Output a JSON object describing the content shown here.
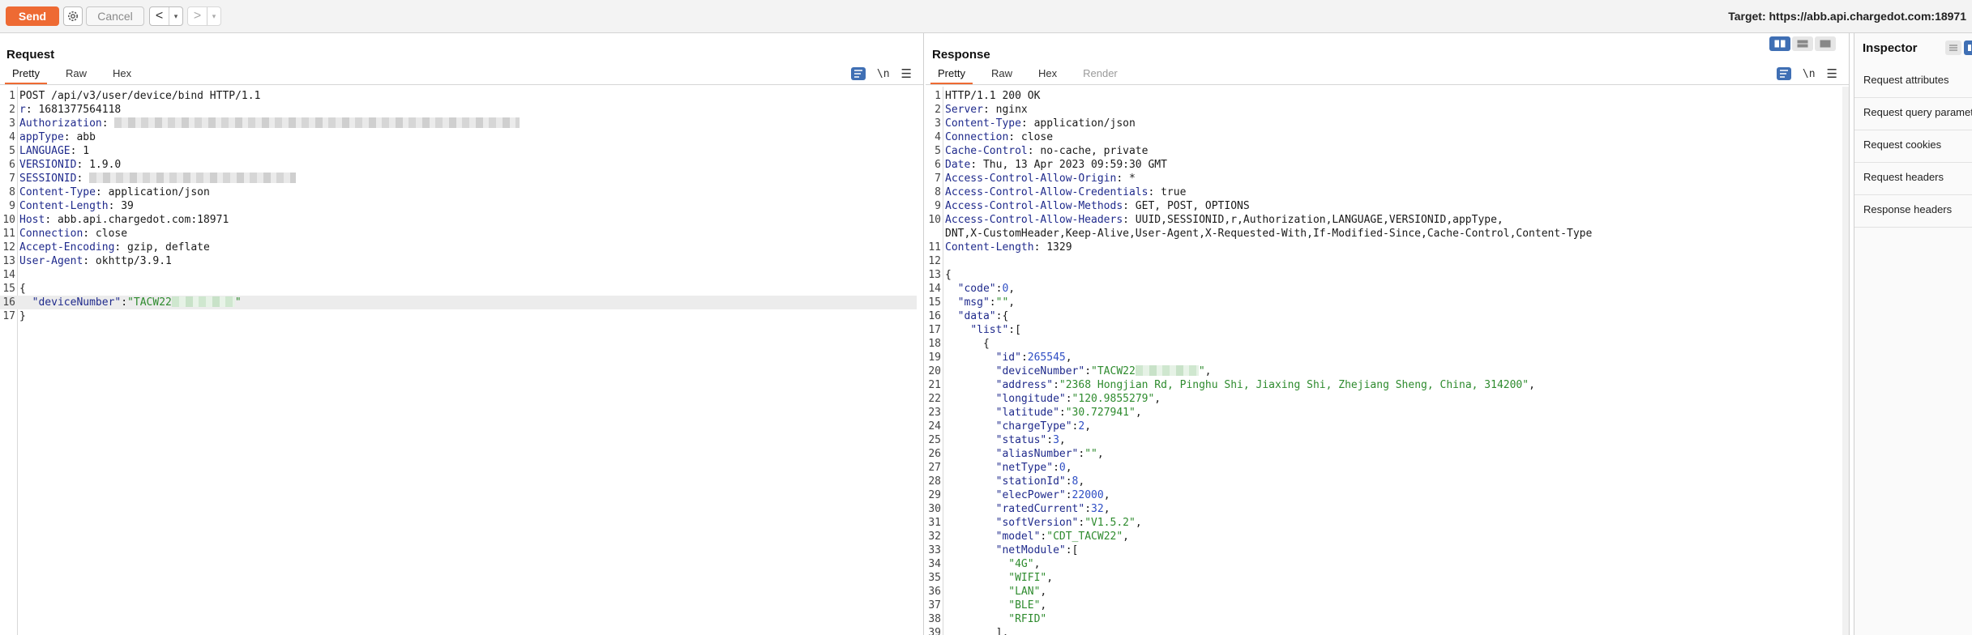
{
  "toolbar": {
    "send_label": "Send",
    "cancel_label": "Cancel",
    "back_arrow": "<",
    "forward_arrow": ">",
    "dropdown_glyph": "▾",
    "target_label": "Target: https://abb.api.chargedot.com:18971",
    "icons": [
      "gear-icon",
      "chevron-left-icon",
      "chevron-right-icon",
      "chevron-down-icon"
    ]
  },
  "colors": {
    "accent": "#ee6a33",
    "key": "#1f2a8c",
    "string": "#2e8b2e",
    "number": "#2e4ec4",
    "tool_blue": "#3f6fb4"
  },
  "request": {
    "title": "Request",
    "tabs": [
      "Pretty",
      "Raw",
      "Hex"
    ],
    "active_tab": "Pretty",
    "tools": {
      "newline_label": "\\n",
      "menu_glyph": "☰"
    },
    "lines": [
      [
        {
          "t": "p",
          "v": "POST /api/v3/user/device/bind HTTP/1.1"
        }
      ],
      [
        {
          "t": "k",
          "v": "r"
        },
        {
          "t": "p",
          "v": ": 1681377564118"
        }
      ],
      [
        {
          "t": "k",
          "v": "Authorization"
        },
        {
          "t": "p",
          "v": ": "
        },
        {
          "t": "r",
          "w": 500
        }
      ],
      [
        {
          "t": "k",
          "v": "appType"
        },
        {
          "t": "p",
          "v": ": abb"
        }
      ],
      [
        {
          "t": "k",
          "v": "LANGUAGE"
        },
        {
          "t": "p",
          "v": ": 1"
        }
      ],
      [
        {
          "t": "k",
          "v": "VERSIONID"
        },
        {
          "t": "p",
          "v": ": 1.9.0"
        }
      ],
      [
        {
          "t": "k",
          "v": "SESSIONID"
        },
        {
          "t": "p",
          "v": ": "
        },
        {
          "t": "r",
          "w": 255
        }
      ],
      [
        {
          "t": "k",
          "v": "Content-Type"
        },
        {
          "t": "p",
          "v": ": application/json"
        }
      ],
      [
        {
          "t": "k",
          "v": "Content-Length"
        },
        {
          "t": "p",
          "v": ": 39"
        }
      ],
      [
        {
          "t": "k",
          "v": "Host"
        },
        {
          "t": "p",
          "v": ": abb.api.chargedot.com:18971"
        }
      ],
      [
        {
          "t": "k",
          "v": "Connection"
        },
        {
          "t": "p",
          "v": ": close"
        }
      ],
      [
        {
          "t": "k",
          "v": "Accept-Encoding"
        },
        {
          "t": "p",
          "v": ": gzip, deflate"
        }
      ],
      [
        {
          "t": "k",
          "v": "User-Agent"
        },
        {
          "t": "p",
          "v": ": okhttp/3.9.1"
        }
      ],
      [],
      [
        {
          "t": "p",
          "v": "{"
        }
      ],
      [
        {
          "t": "p",
          "v": "  "
        },
        {
          "t": "k",
          "v": "\"deviceNumber\""
        },
        {
          "t": "p",
          "v": ":"
        },
        {
          "t": "s",
          "v": "\"TACW22"
        },
        {
          "t": "rg",
          "w": 78
        },
        {
          "t": "s",
          "v": "\""
        }
      ],
      [
        {
          "t": "p",
          "v": "}"
        }
      ]
    ],
    "highlight_line": 16
  },
  "response": {
    "title": "Response",
    "tabs": [
      "Pretty",
      "Raw",
      "Hex",
      "Render"
    ],
    "active_tab": "Pretty",
    "disabled_tab": "Render",
    "tools": {
      "newline_label": "\\n",
      "menu_glyph": "☰"
    },
    "lines": [
      [
        {
          "t": "p",
          "v": "HTTP/1.1 200 OK"
        }
      ],
      [
        {
          "t": "k",
          "v": "Server"
        },
        {
          "t": "p",
          "v": ": nginx"
        }
      ],
      [
        {
          "t": "k",
          "v": "Content-Type"
        },
        {
          "t": "p",
          "v": ": application/json"
        }
      ],
      [
        {
          "t": "k",
          "v": "Connection"
        },
        {
          "t": "p",
          "v": ": close"
        }
      ],
      [
        {
          "t": "k",
          "v": "Cache-Control"
        },
        {
          "t": "p",
          "v": ": no-cache, private"
        }
      ],
      [
        {
          "t": "k",
          "v": "Date"
        },
        {
          "t": "p",
          "v": ": Thu, 13 Apr 2023 09:59:30 GMT"
        }
      ],
      [
        {
          "t": "k",
          "v": "Access-Control-Allow-Origin"
        },
        {
          "t": "p",
          "v": ": *"
        }
      ],
      [
        {
          "t": "k",
          "v": "Access-Control-Allow-Credentials"
        },
        {
          "t": "p",
          "v": ": true"
        }
      ],
      [
        {
          "t": "k",
          "v": "Access-Control-Allow-Methods"
        },
        {
          "t": "p",
          "v": ": GET, POST, OPTIONS"
        }
      ],
      [
        {
          "t": "k",
          "v": "Access-Control-Allow-Headers"
        },
        {
          "t": "p",
          "v": ": UUID,SESSIONID,r,Authorization,LANGUAGE,VERSIONID,appType,"
        }
      ],
      [
        {
          "t": "p",
          "v": "DNT,X-CustomHeader,Keep-Alive,User-Agent,X-Requested-With,If-Modified-Since,Cache-Control,Content-Type"
        }
      ],
      [
        {
          "t": "k",
          "v": "Content-Length"
        },
        {
          "t": "p",
          "v": ": 1329"
        }
      ],
      [],
      [
        {
          "t": "p",
          "v": "{"
        }
      ],
      [
        {
          "t": "p",
          "v": "  "
        },
        {
          "t": "k",
          "v": "\"code\""
        },
        {
          "t": "p",
          "v": ":"
        },
        {
          "t": "n",
          "v": "0"
        },
        {
          "t": "p",
          "v": ","
        }
      ],
      [
        {
          "t": "p",
          "v": "  "
        },
        {
          "t": "k",
          "v": "\"msg\""
        },
        {
          "t": "p",
          "v": ":"
        },
        {
          "t": "s",
          "v": "\"\""
        },
        {
          "t": "p",
          "v": ","
        }
      ],
      [
        {
          "t": "p",
          "v": "  "
        },
        {
          "t": "k",
          "v": "\"data\""
        },
        {
          "t": "p",
          "v": ":{"
        }
      ],
      [
        {
          "t": "p",
          "v": "    "
        },
        {
          "t": "k",
          "v": "\"list\""
        },
        {
          "t": "p",
          "v": ":["
        }
      ],
      [
        {
          "t": "p",
          "v": "      {"
        }
      ],
      [
        {
          "t": "p",
          "v": "        "
        },
        {
          "t": "k",
          "v": "\"id\""
        },
        {
          "t": "p",
          "v": ":"
        },
        {
          "t": "n",
          "v": "265545"
        },
        {
          "t": "p",
          "v": ","
        }
      ],
      [
        {
          "t": "p",
          "v": "        "
        },
        {
          "t": "k",
          "v": "\"deviceNumber\""
        },
        {
          "t": "p",
          "v": ":"
        },
        {
          "t": "s",
          "v": "\"TACW22"
        },
        {
          "t": "rg",
          "w": 78
        },
        {
          "t": "s",
          "v": "\""
        },
        {
          "t": "p",
          "v": ","
        }
      ],
      [
        {
          "t": "p",
          "v": "        "
        },
        {
          "t": "k",
          "v": "\"address\""
        },
        {
          "t": "p",
          "v": ":"
        },
        {
          "t": "s",
          "v": "\"2368 Hongjian Rd, Pinghu Shi, Jiaxing Shi, Zhejiang Sheng, China, 314200\""
        },
        {
          "t": "p",
          "v": ","
        }
      ],
      [
        {
          "t": "p",
          "v": "        "
        },
        {
          "t": "k",
          "v": "\"longitude\""
        },
        {
          "t": "p",
          "v": ":"
        },
        {
          "t": "s",
          "v": "\"120.9855279\""
        },
        {
          "t": "p",
          "v": ","
        }
      ],
      [
        {
          "t": "p",
          "v": "        "
        },
        {
          "t": "k",
          "v": "\"latitude\""
        },
        {
          "t": "p",
          "v": ":"
        },
        {
          "t": "s",
          "v": "\"30.727941\""
        },
        {
          "t": "p",
          "v": ","
        }
      ],
      [
        {
          "t": "p",
          "v": "        "
        },
        {
          "t": "k",
          "v": "\"chargeType\""
        },
        {
          "t": "p",
          "v": ":"
        },
        {
          "t": "n",
          "v": "2"
        },
        {
          "t": "p",
          "v": ","
        }
      ],
      [
        {
          "t": "p",
          "v": "        "
        },
        {
          "t": "k",
          "v": "\"status\""
        },
        {
          "t": "p",
          "v": ":"
        },
        {
          "t": "n",
          "v": "3"
        },
        {
          "t": "p",
          "v": ","
        }
      ],
      [
        {
          "t": "p",
          "v": "        "
        },
        {
          "t": "k",
          "v": "\"aliasNumber\""
        },
        {
          "t": "p",
          "v": ":"
        },
        {
          "t": "s",
          "v": "\"\""
        },
        {
          "t": "p",
          "v": ","
        }
      ],
      [
        {
          "t": "p",
          "v": "        "
        },
        {
          "t": "k",
          "v": "\"netType\""
        },
        {
          "t": "p",
          "v": ":"
        },
        {
          "t": "n",
          "v": "0"
        },
        {
          "t": "p",
          "v": ","
        }
      ],
      [
        {
          "t": "p",
          "v": "        "
        },
        {
          "t": "k",
          "v": "\"stationId\""
        },
        {
          "t": "p",
          "v": ":"
        },
        {
          "t": "n",
          "v": "8"
        },
        {
          "t": "p",
          "v": ","
        }
      ],
      [
        {
          "t": "p",
          "v": "        "
        },
        {
          "t": "k",
          "v": "\"elecPower\""
        },
        {
          "t": "p",
          "v": ":"
        },
        {
          "t": "n",
          "v": "22000"
        },
        {
          "t": "p",
          "v": ","
        }
      ],
      [
        {
          "t": "p",
          "v": "        "
        },
        {
          "t": "k",
          "v": "\"ratedCurrent\""
        },
        {
          "t": "p",
          "v": ":"
        },
        {
          "t": "n",
          "v": "32"
        },
        {
          "t": "p",
          "v": ","
        }
      ],
      [
        {
          "t": "p",
          "v": "        "
        },
        {
          "t": "k",
          "v": "\"softVersion\""
        },
        {
          "t": "p",
          "v": ":"
        },
        {
          "t": "s",
          "v": "\"V1.5.2\""
        },
        {
          "t": "p",
          "v": ","
        }
      ],
      [
        {
          "t": "p",
          "v": "        "
        },
        {
          "t": "k",
          "v": "\"model\""
        },
        {
          "t": "p",
          "v": ":"
        },
        {
          "t": "s",
          "v": "\"CDT_TACW22\""
        },
        {
          "t": "p",
          "v": ","
        }
      ],
      [
        {
          "t": "p",
          "v": "        "
        },
        {
          "t": "k",
          "v": "\"netModule\""
        },
        {
          "t": "p",
          "v": ":["
        }
      ],
      [
        {
          "t": "p",
          "v": "          "
        },
        {
          "t": "s",
          "v": "\"4G\""
        },
        {
          "t": "p",
          "v": ","
        }
      ],
      [
        {
          "t": "p",
          "v": "          "
        },
        {
          "t": "s",
          "v": "\"WIFI\""
        },
        {
          "t": "p",
          "v": ","
        }
      ],
      [
        {
          "t": "p",
          "v": "          "
        },
        {
          "t": "s",
          "v": "\"LAN\""
        },
        {
          "t": "p",
          "v": ","
        }
      ],
      [
        {
          "t": "p",
          "v": "          "
        },
        {
          "t": "s",
          "v": "\"BLE\""
        },
        {
          "t": "p",
          "v": ","
        }
      ],
      [
        {
          "t": "p",
          "v": "          "
        },
        {
          "t": "s",
          "v": "\"RFID\""
        }
      ],
      [
        {
          "t": "p",
          "v": "        ],"
        }
      ]
    ],
    "numbered_logical": [
      1,
      2,
      3,
      4,
      5,
      6,
      7,
      8,
      9,
      10,
      null,
      11,
      12,
      13
    ]
  },
  "inspector": {
    "title": "Inspector",
    "items": [
      "Request attributes",
      "Request query parameters",
      "Request cookies",
      "Request headers",
      "Response headers"
    ]
  }
}
